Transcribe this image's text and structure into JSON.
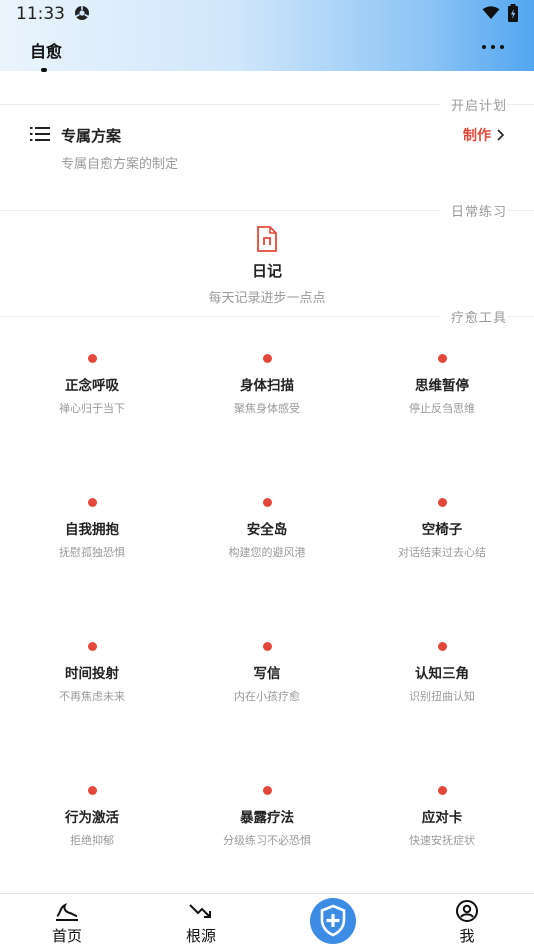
{
  "status_bar": {
    "time": "11:33"
  },
  "header": {
    "title": "自愈"
  },
  "sections": {
    "plan": "开启计划",
    "daily": "日常练习",
    "tools": "疗愈工具"
  },
  "plan": {
    "title": "专属方案",
    "subtitle": "专属自愈方案的制定",
    "action": "制作"
  },
  "diary": {
    "title": "日记",
    "subtitle": "每天记录进步一点点"
  },
  "tools": [
    {
      "title": "正念呼吸",
      "subtitle": "禅心归于当下"
    },
    {
      "title": "身体扫描",
      "subtitle": "聚焦身体感受"
    },
    {
      "title": "思维暂停",
      "subtitle": "停止反刍思维"
    },
    {
      "title": "自我拥抱",
      "subtitle": "抚慰孤独恐惧"
    },
    {
      "title": "安全岛",
      "subtitle": "构建您的避风港"
    },
    {
      "title": "空椅子",
      "subtitle": "对话结束过去心结"
    },
    {
      "title": "时间投射",
      "subtitle": "不再焦虑未来"
    },
    {
      "title": "写信",
      "subtitle": "内在小孩疗愈"
    },
    {
      "title": "认知三角",
      "subtitle": "识别扭曲认知"
    },
    {
      "title": "行为激活",
      "subtitle": "拒绝抑郁"
    },
    {
      "title": "暴露疗法",
      "subtitle": "分级练习不必恐惧"
    },
    {
      "title": "应对卡",
      "subtitle": "快速安抚症状"
    }
  ],
  "tool_dot_color": "#e5483b",
  "accent_color": "#e24a3b",
  "nav": {
    "home": "首页",
    "source": "根源",
    "me": "我",
    "center_icon": "shield-plus-icon"
  }
}
